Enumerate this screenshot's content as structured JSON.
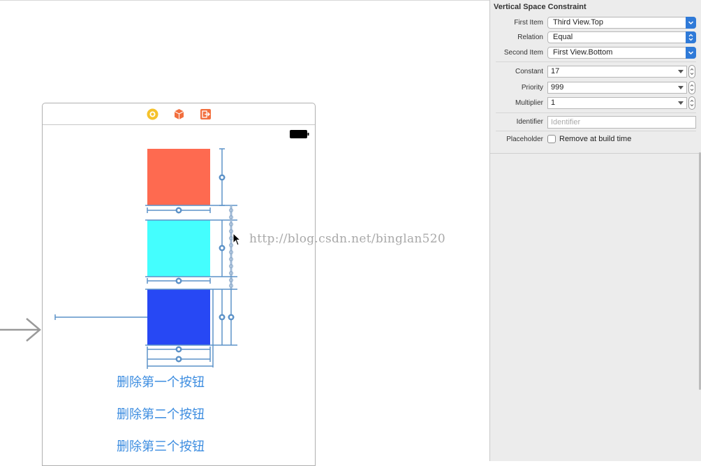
{
  "canvas": {
    "buttons": [
      "删除第一个按钮",
      "删除第二个按钮",
      "删除第三个按钮"
    ],
    "watermark": "http://blog.csdn.net/binglan520",
    "colors": {
      "view1": "#fe6a50",
      "view2": "#44fefe",
      "view3": "#2748f4",
      "guide": "#5c92c8"
    },
    "icons": [
      "view-controller-icon",
      "first-responder-icon",
      "exit-icon",
      "battery-icon",
      "entry-arrow-icon",
      "pointer-cursor-icon"
    ]
  },
  "inspector": {
    "title": "Vertical Space Constraint",
    "first_item": {
      "label": "First Item",
      "value": "Third View.Top"
    },
    "relation": {
      "label": "Relation",
      "value": "Equal"
    },
    "second_item": {
      "label": "Second Item",
      "value": "First View.Bottom"
    },
    "constant": {
      "label": "Constant",
      "value": "17"
    },
    "priority": {
      "label": "Priority",
      "value": "999"
    },
    "multiplier": {
      "label": "Multiplier",
      "value": "1"
    },
    "identifier": {
      "label": "Identifier",
      "placeholder": "Identifier"
    },
    "placeholder": {
      "label": "Placeholder",
      "checkbox_label": "Remove at build time"
    }
  }
}
